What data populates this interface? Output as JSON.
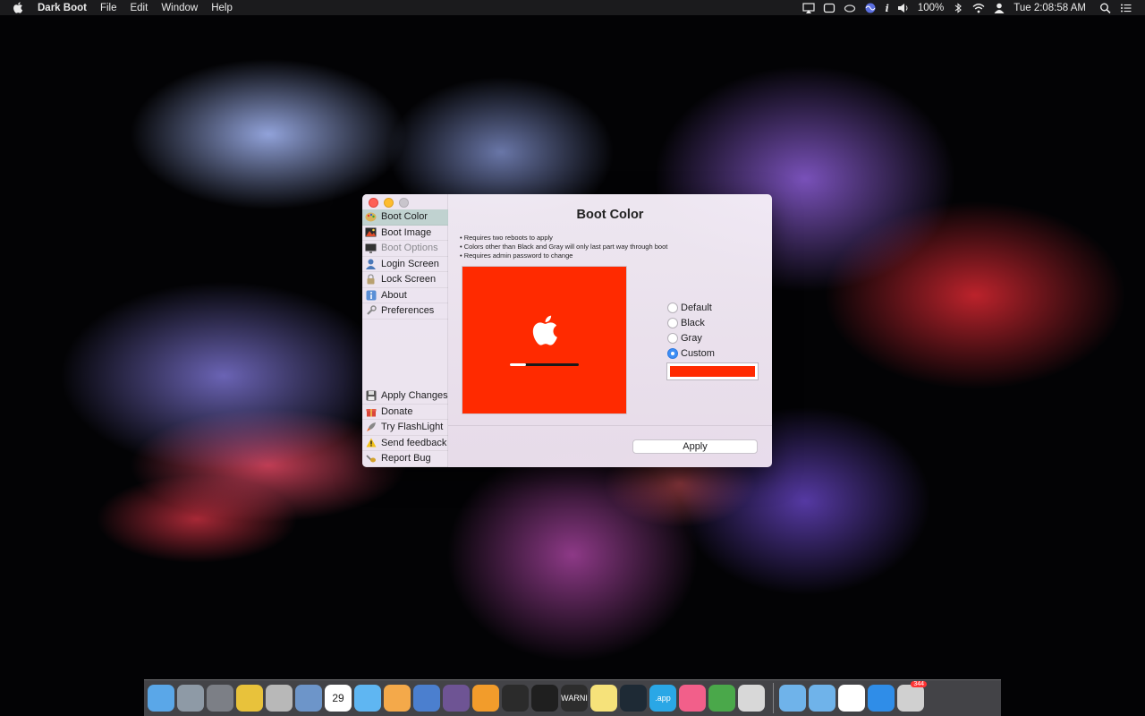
{
  "menubar": {
    "app_name": "Dark Boot",
    "menus": [
      "File",
      "Edit",
      "Window",
      "Help"
    ],
    "battery": "100%",
    "clock": "Tue 2:08:58 AM",
    "status_icons": [
      "airplay-icon",
      "display-icon",
      "creative-cloud-icon",
      "siri-icon",
      "info-icon",
      "volume-icon",
      "bluetooth-icon",
      "wifi-icon",
      "user-icon",
      "spotlight-icon",
      "notification-center-icon"
    ]
  },
  "window": {
    "title": "Boot Color",
    "sidebar_top": [
      {
        "label": "Boot Color",
        "icon": "palette-icon",
        "state": "selected"
      },
      {
        "label": "Boot Image",
        "icon": "image-icon",
        "state": "normal"
      },
      {
        "label": "Boot Options",
        "icon": "display-icon",
        "state": "disabled"
      },
      {
        "label": "Login Screen",
        "icon": "user-icon",
        "state": "normal"
      },
      {
        "label": "Lock Screen",
        "icon": "lock-icon",
        "state": "normal"
      },
      {
        "label": "About",
        "icon": "info-icon",
        "state": "normal"
      },
      {
        "label": "Preferences",
        "icon": "wrench-icon",
        "state": "normal"
      }
    ],
    "sidebar_bottom": [
      {
        "label": "Apply Changes",
        "icon": "floppy-icon"
      },
      {
        "label": "Donate",
        "icon": "gift-icon"
      },
      {
        "label": "Try FlashLight",
        "icon": "rocket-icon"
      },
      {
        "label": "Send feedback",
        "icon": "warning-icon"
      },
      {
        "label": "Report Bug",
        "icon": "bug-icon"
      }
    ],
    "notes": [
      "• Requires two reboots to apply",
      "• Colors other than Black and Gray will only last part way through boot",
      "• Requires admin password to change"
    ],
    "preview": {
      "background_color": "#ff2a00",
      "progress": 0.23
    },
    "color_options": [
      {
        "label": "Default",
        "selected": false
      },
      {
        "label": "Black",
        "selected": false
      },
      {
        "label": "Gray",
        "selected": false
      },
      {
        "label": "Custom",
        "selected": true
      }
    ],
    "custom_color": "#ff2a00",
    "apply_label": "Apply"
  },
  "dock": {
    "apps": [
      {
        "name": "finder-icon",
        "color": "#5aa7e8"
      },
      {
        "name": "launchpad-icon",
        "color": "#8e9aa6"
      },
      {
        "name": "system-preferences-icon",
        "color": "#7c7f86"
      },
      {
        "name": "chrome-icon",
        "color": "#e8c23b"
      },
      {
        "name": "disk-utility-icon",
        "color": "#b8b8b8"
      },
      {
        "name": "preview-icon",
        "color": "#6d95c9"
      },
      {
        "name": "calendar-icon",
        "color": "#ffffff",
        "label": "29"
      },
      {
        "name": "messages-icon",
        "color": "#5fb6f2"
      },
      {
        "name": "photos-icon",
        "color": "#f4a94a"
      },
      {
        "name": "xcode-icon",
        "color": "#4b7fcf"
      },
      {
        "name": "github-desktop-icon",
        "color": "#6e5494"
      },
      {
        "name": "sublime-text-icon",
        "color": "#f29c2b"
      },
      {
        "name": "activity-monitor-icon",
        "color": "#2b2b2b"
      },
      {
        "name": "terminal-icon",
        "color": "#1f1f1f"
      },
      {
        "name": "console-icon",
        "color": "#2d2d2d",
        "label": "WARNI"
      },
      {
        "name": "notes-icon",
        "color": "#f6e27a"
      },
      {
        "name": "atom-icon",
        "color": "#1e2a35"
      },
      {
        "name": "app-icon",
        "color": "#2aa7e6",
        "label": ".app"
      },
      {
        "name": "itunes-icon",
        "color": "#f25f8a"
      },
      {
        "name": "leaf-icon",
        "color": "#4aa84a"
      },
      {
        "name": "display-app-icon",
        "color": "#d8d8d8"
      }
    ],
    "folders": [
      {
        "name": "applications-folder-icon",
        "color": "#6fb3ea"
      },
      {
        "name": "downloads-folder-icon",
        "color": "#6fb3ea"
      },
      {
        "name": "chrome-doc-icon",
        "color": "#ffffff"
      },
      {
        "name": "app-store-icon",
        "color": "#2f8de8"
      },
      {
        "name": "trash-icon",
        "color": "#d0d0d0",
        "badge": "344"
      }
    ]
  }
}
